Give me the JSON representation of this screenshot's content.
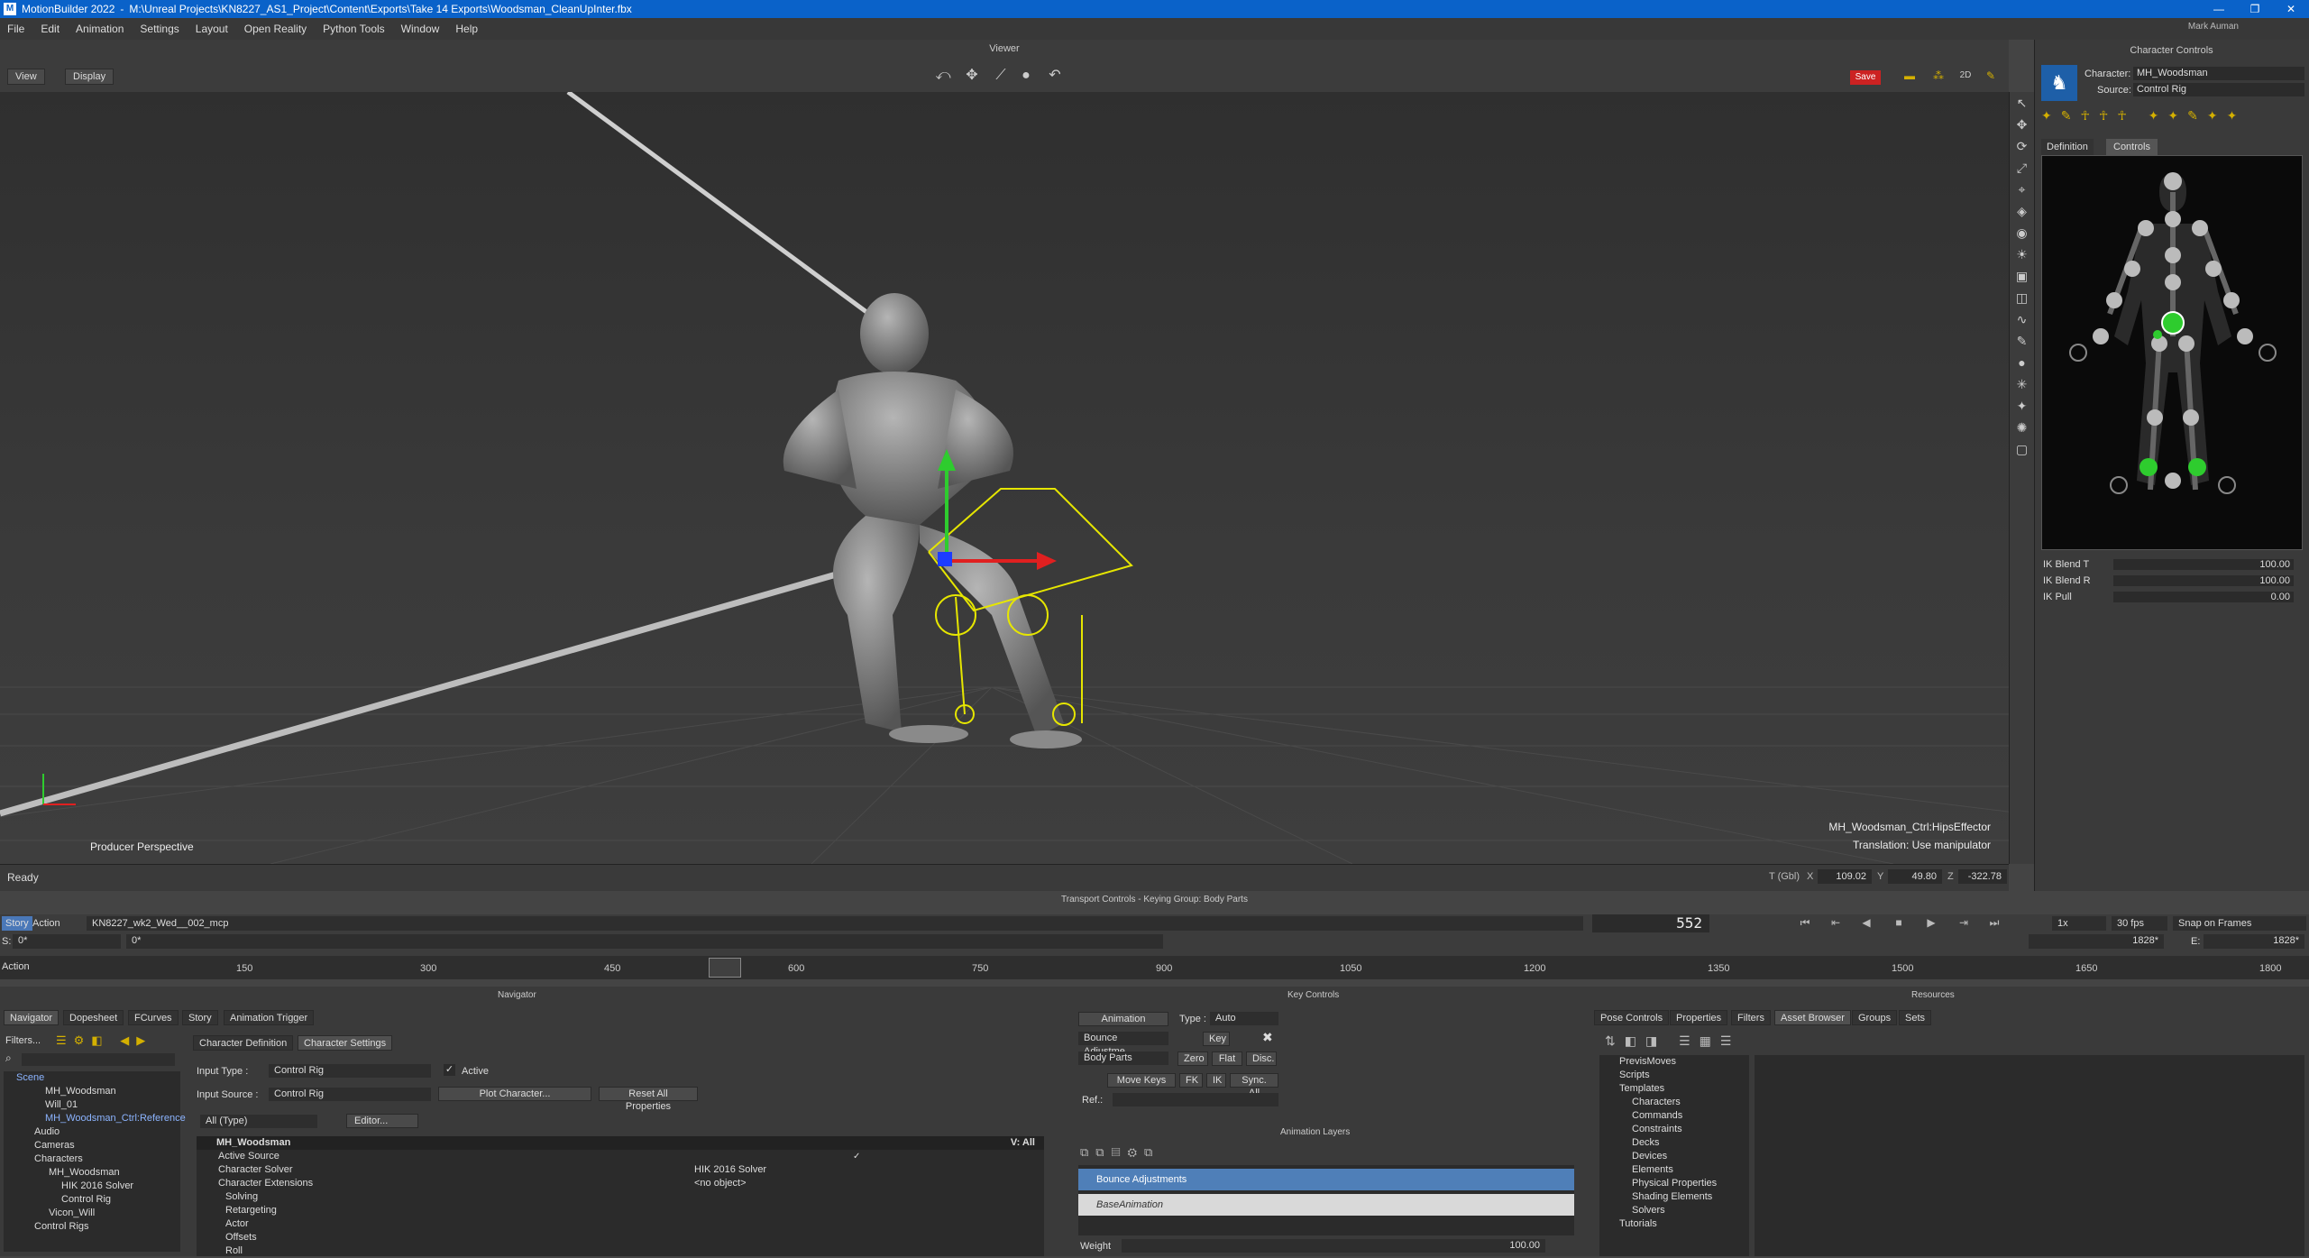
{
  "window": {
    "app": "MotionBuilder 2022",
    "path": "M:\\Unreal Projects\\KN8227_AS1_Project\\Content\\Exports\\Take 14 Exports\\Woodsman_CleanUpInter.fbx",
    "user": "Mark Auman",
    "controls": [
      "—",
      "❐",
      "✕"
    ]
  },
  "menu": [
    "File",
    "Edit",
    "Animation",
    "Settings",
    "Layout",
    "Open Reality",
    "Python Tools",
    "Window",
    "Help"
  ],
  "viewer": {
    "title": "Viewer",
    "view_btn": "View",
    "display_btn": "Display",
    "save_label": "Save",
    "camera_label": "Producer Perspective",
    "selected": "MH_Woodsman_Ctrl:HipsEffector",
    "hint": "Translation: Use manipulator"
  },
  "status": {
    "text": "Ready",
    "t_label": "T (Gbl)",
    "x_label": "X",
    "x": "109.02",
    "y_label": "Y",
    "y": "49.80",
    "z_label": "Z",
    "z": "-322.78"
  },
  "character_controls": {
    "title": "Character Controls",
    "character_label": "Character:",
    "character": "MH_Woodsman",
    "source_label": "Source:",
    "source": "Control Rig",
    "tabs": [
      "Definition",
      "Controls"
    ],
    "ik": [
      {
        "name": "IK Blend T",
        "value": "100.00"
      },
      {
        "name": "IK Blend R",
        "value": "100.00"
      },
      {
        "name": "IK Pull",
        "value": "0.00"
      }
    ]
  },
  "transport": {
    "title": "Transport Controls  -  Keying Group: Body Parts",
    "mode": "Story",
    "action": "Action",
    "take": "KN8227_wk2_Wed__002_mcp",
    "frame": "552",
    "speed": "1x",
    "fps": "30 fps",
    "snap": "Snap on Frames",
    "start_label": "S:",
    "start": "0*",
    "end_label": "E:",
    "end": "1828*",
    "end_field": "1828*",
    "row2_field": "0*",
    "action_label": "Action",
    "ticks": [
      "150",
      "300",
      "450",
      "600",
      "750",
      "900",
      "1050",
      "1200",
      "1350",
      "1500",
      "1650",
      "1800"
    ]
  },
  "navigator": {
    "title": "Navigator",
    "tabs": [
      "Navigator",
      "Dopesheet",
      "FCurves",
      "Story",
      "Animation Trigger"
    ],
    "filters": "Filters...",
    "tree": [
      "Scene",
      "MH_Woodsman",
      "Will_01",
      "MH_Woodsman_Ctrl:Reference",
      "Audio",
      "Cameras",
      "Characters",
      "MH_Woodsman",
      "HIK 2016 Solver",
      "Control Rig",
      "Vicon_Will",
      "Control Rigs"
    ]
  },
  "character_settings": {
    "tabs": [
      "Character Definition",
      "Character Settings"
    ],
    "input_type_label": "Input Type :",
    "input_type": "Control Rig",
    "active_label": "Active",
    "input_source_label": "Input Source :",
    "input_source": "Control Rig",
    "plot_btn": "Plot Character...",
    "reset_btn": "Reset All Properties",
    "filter": "All (Type)",
    "editor_btn": "Editor...",
    "header_name": "MH_Woodsman",
    "header_right": "V: All",
    "rows": [
      {
        "name": "Active Source",
        "value": ""
      },
      {
        "name": "Character Solver",
        "value": "HIK 2016 Solver"
      },
      {
        "name": "Character Extensions",
        "value": "<no object>"
      },
      {
        "name": "Solving",
        "value": ""
      },
      {
        "name": "Retargeting",
        "value": ""
      },
      {
        "name": "Actor",
        "value": ""
      },
      {
        "name": "Offsets",
        "value": ""
      },
      {
        "name": "Roll",
        "value": ""
      }
    ]
  },
  "key_controls": {
    "title": "Key Controls",
    "animation_btn": "Animation",
    "type_label": "Type :",
    "type": "Auto",
    "layer_sel": "Bounce Adjustme...",
    "key_btn": "Key",
    "group_sel": "Body Parts",
    "zero_btn": "Zero",
    "flat_btn": "Flat",
    "disc_btn": "Disc.",
    "move_keys": "Move Keys",
    "fk_btn": "FK",
    "ik_btn": "IK",
    "sync_btn": "Sync. All",
    "ref_label": "Ref.:",
    "layers_title": "Animation Layers",
    "layers": [
      "Bounce Adjustments",
      "BaseAnimation"
    ],
    "weight_label": "Weight",
    "weight": "100.00"
  },
  "resources": {
    "title": "Resources",
    "tabs": [
      "Pose Controls",
      "Properties",
      "Filters",
      "Asset Browser",
      "Groups",
      "Sets"
    ],
    "tree": [
      "PrevisMoves",
      "Scripts",
      "Templates",
      "Characters",
      "Commands",
      "Constraints",
      "Decks",
      "Devices",
      "Elements",
      "Physical Properties",
      "Shading Elements",
      "Solvers",
      "Tutorials"
    ]
  }
}
